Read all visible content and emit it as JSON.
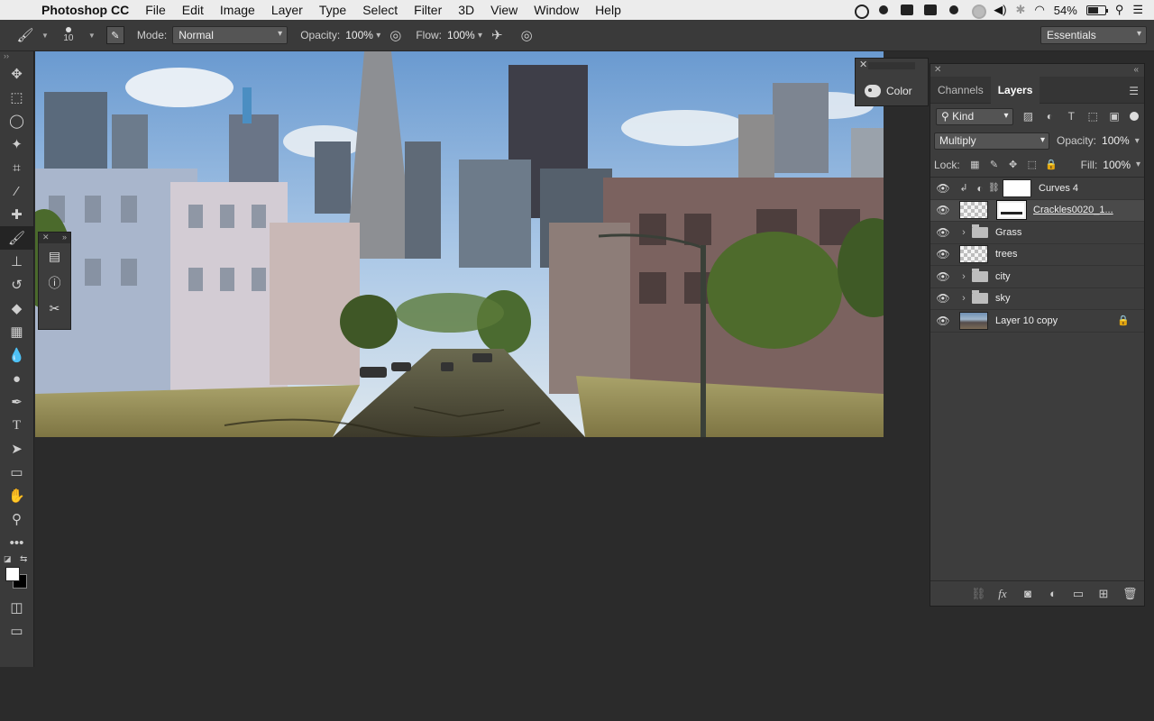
{
  "menubar": {
    "app_name": "Photoshop CC",
    "items": [
      "File",
      "Edit",
      "Image",
      "Layer",
      "Type",
      "Select",
      "Filter",
      "3D",
      "View",
      "Window",
      "Help"
    ],
    "battery": "54%"
  },
  "options": {
    "brush_size": "10",
    "mode_label": "Mode:",
    "mode_value": "Normal",
    "opacity_label": "Opacity:",
    "opacity_value": "100%",
    "flow_label": "Flow:",
    "flow_value": "100%",
    "workspace": "Essentials"
  },
  "color_panel": {
    "label": "Color"
  },
  "layers_panel": {
    "tabs": [
      "Channels",
      "Layers"
    ],
    "kind_label": "Kind",
    "blend_mode": "Multiply",
    "opacity_label": "Opacity:",
    "opacity_value": "100%",
    "lock_label": "Lock:",
    "fill_label": "Fill:",
    "fill_value": "100%",
    "layers": [
      {
        "name": "Curves 4"
      },
      {
        "name": "Crackles0020_1..."
      },
      {
        "name": "Grass"
      },
      {
        "name": "trees"
      },
      {
        "name": "city"
      },
      {
        "name": "sky"
      },
      {
        "name": "Layer 10 copy"
      }
    ]
  },
  "colors": {
    "app_bg": "#2b2b2b",
    "panel_bg": "#3d3d3d",
    "menubar_bg": "#ececec"
  }
}
